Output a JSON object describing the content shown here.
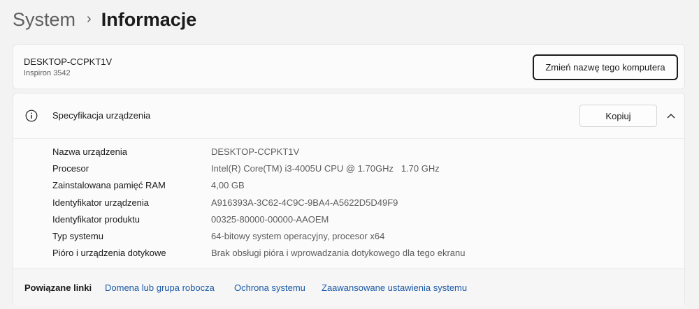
{
  "breadcrumb": {
    "parent": "System",
    "separator": "›",
    "current": "Informacje"
  },
  "device_card": {
    "name": "DESKTOP-CCPKT1V",
    "model": "Inspiron 3542",
    "rename_button": "Zmień nazwę tego komputera"
  },
  "specs": {
    "title": "Specyfikacja urządzenia",
    "copy_button": "Kopiuj",
    "header_icon": "info-icon",
    "collapse_icon": "chevron-up-icon",
    "rows": [
      {
        "label": "Nazwa urządzenia",
        "value": "DESKTOP-CCPKT1V"
      },
      {
        "label": "Procesor",
        "value": "Intel(R) Core(TM) i3-4005U CPU @ 1.70GHz   1.70 GHz"
      },
      {
        "label": "Zainstalowana pamięć RAM",
        "value": "4,00 GB"
      },
      {
        "label": "Identyfikator urządzenia",
        "value": "A916393A-3C62-4C9C-9BA4-A5622D5D49F9"
      },
      {
        "label": "Identyfikator produktu",
        "value": "00325-80000-00000-AAOEM"
      },
      {
        "label": "Typ systemu",
        "value": "64-bitowy system operacyjny, procesor x64"
      },
      {
        "label": "Pióro i urządzenia dotykowe",
        "value": "Brak obsługi pióra i wprowadzania dotykowego dla tego ekranu"
      }
    ]
  },
  "related_links": {
    "label": "Powiązane linki",
    "links": [
      "Domena lub grupa robocza",
      "Ochrona systemu",
      "Zaawansowane ustawienia systemu"
    ]
  },
  "colors": {
    "background": "#f3f3f3",
    "card": "#fbfbfb",
    "link": "#1b5aa6",
    "secondary_text": "#5d5d5d"
  }
}
